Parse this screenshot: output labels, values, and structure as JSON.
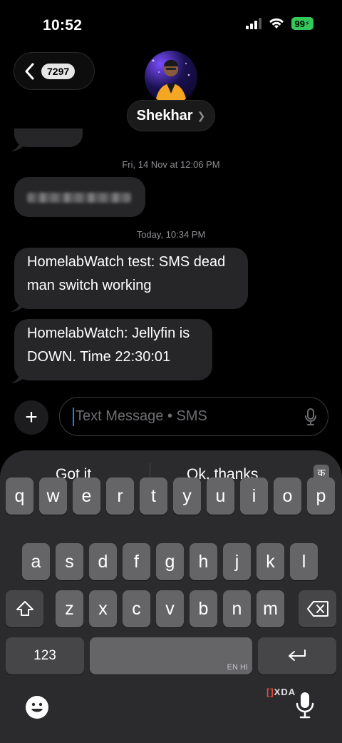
{
  "status_bar": {
    "time": "10:52",
    "battery": "99"
  },
  "header": {
    "back_badge": "7297",
    "contact_name": "Shekhar"
  },
  "messages": {
    "timestamp_1": "Fri, 14 Nov at 12:06 PM",
    "timestamp_2": "Today, 10:34 PM",
    "bubble_1": [
      "HomelabWatch test: SMS dead",
      "man switch working"
    ],
    "bubble_2": [
      "HomelabWatch: Jellyfin is",
      "DOWN. Time 22:30:01"
    ]
  },
  "composer": {
    "placeholder": "Text Message • SMS"
  },
  "keyboard": {
    "suggestions": [
      "Got it",
      "Ok, thanks"
    ],
    "lang_key": "क",
    "row1": [
      "q",
      "w",
      "e",
      "r",
      "t",
      "y",
      "u",
      "i",
      "o",
      "p"
    ],
    "row2": [
      "a",
      "s",
      "d",
      "f",
      "g",
      "h",
      "j",
      "k",
      "l"
    ],
    "row3": [
      "z",
      "x",
      "c",
      "v",
      "b",
      "n",
      "m"
    ],
    "numbers_key": "123",
    "space_lang": "EN HI",
    "watermark": "XDA"
  },
  "colors": {
    "accent": "#0a84ff",
    "battery": "#34c759",
    "bubble": "#262628"
  }
}
